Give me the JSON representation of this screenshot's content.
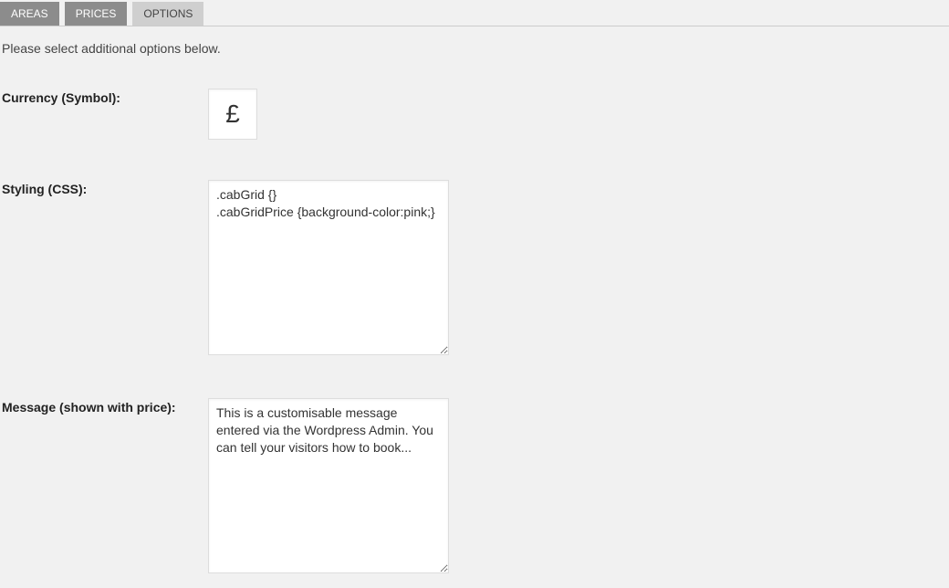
{
  "tabs": {
    "areas": "AREAS",
    "prices": "PRICES",
    "options": "OPTIONS"
  },
  "intro": "Please select additional options below.",
  "fields": {
    "currency": {
      "label": "Currency (Symbol):",
      "value": "£"
    },
    "styling": {
      "label": "Styling (CSS):",
      "value": ".cabGrid {}\n.cabGridPrice {background-color:pink;}"
    },
    "message": {
      "label": "Message (shown with price):",
      "value": "This is a customisable message entered via the Wordpress Admin. You can tell your visitors how to book..."
    }
  }
}
